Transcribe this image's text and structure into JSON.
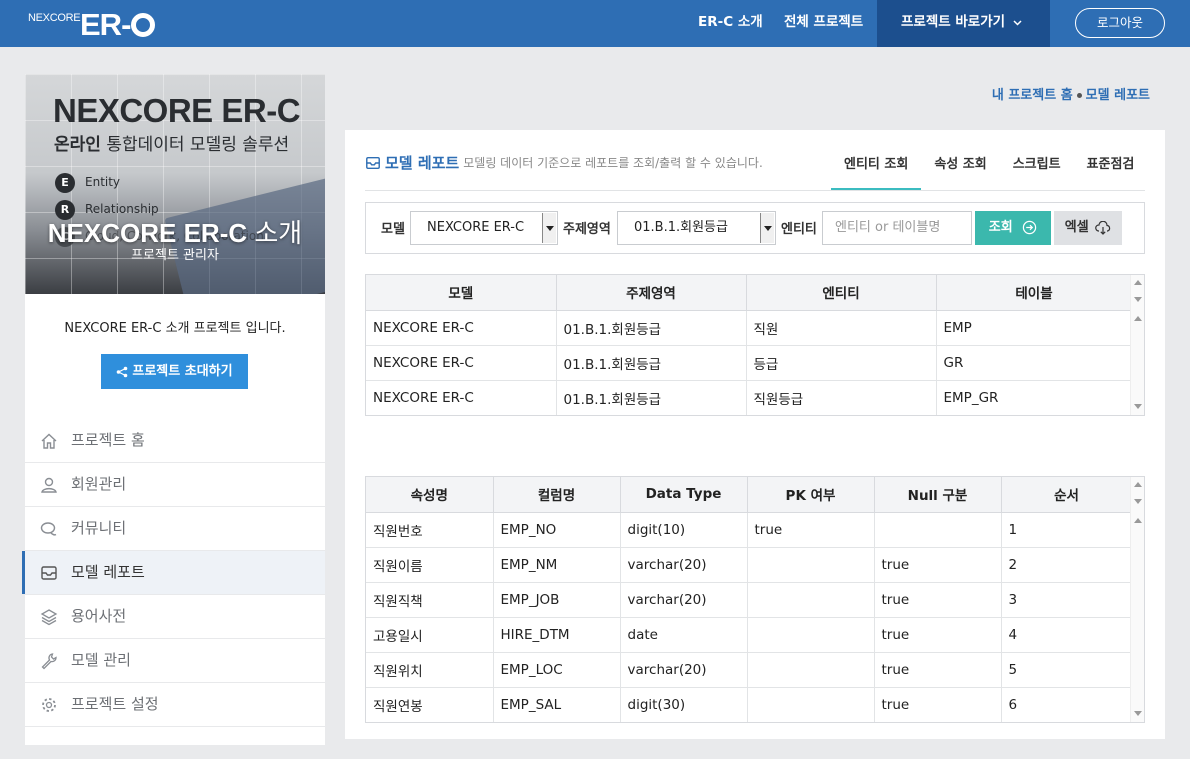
{
  "header": {
    "logo_small": "NEXCORE",
    "logo_big": "ER-",
    "nav": [
      "ER-C 소개",
      "전체 프로젝트",
      "프로젝트 바로가기"
    ],
    "logout": "로그아웃"
  },
  "sidebar": {
    "banner": {
      "title": "NEXCORE ER-C",
      "subtitle_bold": "온라인",
      "subtitle_rest": " 통합데이터 모델링 솔루션",
      "er_items": [
        {
          "letter": "E",
          "text": "Entity"
        },
        {
          "letter": "R",
          "text": "Relationship"
        },
        {
          "letter": "C",
          "text": "Cloud, Co-work, Collaboration"
        }
      ],
      "project_name": "NEXCORE ER-C",
      "project_name_suffix": " 소개",
      "project_role": "프로젝트 관리자"
    },
    "description": "NEXCORE ER-C 소개 프로젝트 입니다.",
    "invite_button": "프로젝트 초대하기",
    "menu": [
      {
        "label": "프로젝트 홈",
        "icon": "home-icon"
      },
      {
        "label": "회원관리",
        "icon": "user-icon"
      },
      {
        "label": "커뮤니티",
        "icon": "chat-icon"
      },
      {
        "label": "모델 레포트",
        "icon": "inbox-icon"
      },
      {
        "label": "용어사전",
        "icon": "layers-icon"
      },
      {
        "label": "모델 관리",
        "icon": "wrench-icon"
      },
      {
        "label": "프로젝트 설정",
        "icon": "gear-icon"
      }
    ]
  },
  "breadcrumb": {
    "home": "내 프로젝트 홈",
    "current": "모델 레포트"
  },
  "main": {
    "title": "모델 레포트",
    "description": "모델링 데이터 기준으로 레포트를 조회/출력 할 수 있습니다.",
    "tabs": [
      "엔티티 조회",
      "속성 조회",
      "스크립트",
      "표준점검"
    ],
    "filter": {
      "model_label": "모델",
      "model_value": "NEXCORE ER-C",
      "area_label": "주제영역",
      "area_value": "01.B.1.회원등급",
      "entity_label": "엔티티",
      "entity_placeholder": "엔티티 or 테이블명",
      "search_button": "조회",
      "excel_button": "엑셀"
    },
    "entity_table": {
      "headers": [
        "모델",
        "주제영역",
        "엔티티",
        "테이블"
      ],
      "rows": [
        [
          "NEXCORE ER-C",
          "01.B.1.회원등급",
          "직원",
          "EMP"
        ],
        [
          "NEXCORE ER-C",
          "01.B.1.회원등급",
          "등급",
          "GR"
        ],
        [
          "NEXCORE ER-C",
          "01.B.1.회원등급",
          "직원등급",
          "EMP_GR"
        ]
      ]
    },
    "attr_table": {
      "headers": [
        "속성명",
        "컬럼명",
        "Data Type",
        "PK 여부",
        "Null 구분",
        "순서"
      ],
      "rows": [
        [
          "직원번호",
          "EMP_NO",
          "digit(10)",
          "true",
          "",
          "1"
        ],
        [
          "직원이름",
          "EMP_NM",
          "varchar(20)",
          "",
          "true",
          "2"
        ],
        [
          "직원직책",
          "EMP_JOB",
          "varchar(20)",
          "",
          "true",
          "3"
        ],
        [
          "고용일시",
          "HIRE_DTM",
          "date",
          "",
          "true",
          "4"
        ],
        [
          "직원위치",
          "EMP_LOC",
          "varchar(20)",
          "",
          "true",
          "5"
        ],
        [
          "직원연봉",
          "EMP_SAL",
          "digit(30)",
          "",
          "true",
          "6"
        ]
      ]
    }
  },
  "colors": {
    "primary": "#2e6eb4",
    "nav_active": "#1c4f8e",
    "accent": "#3bbcc0",
    "invite": "#2f8fdc"
  }
}
